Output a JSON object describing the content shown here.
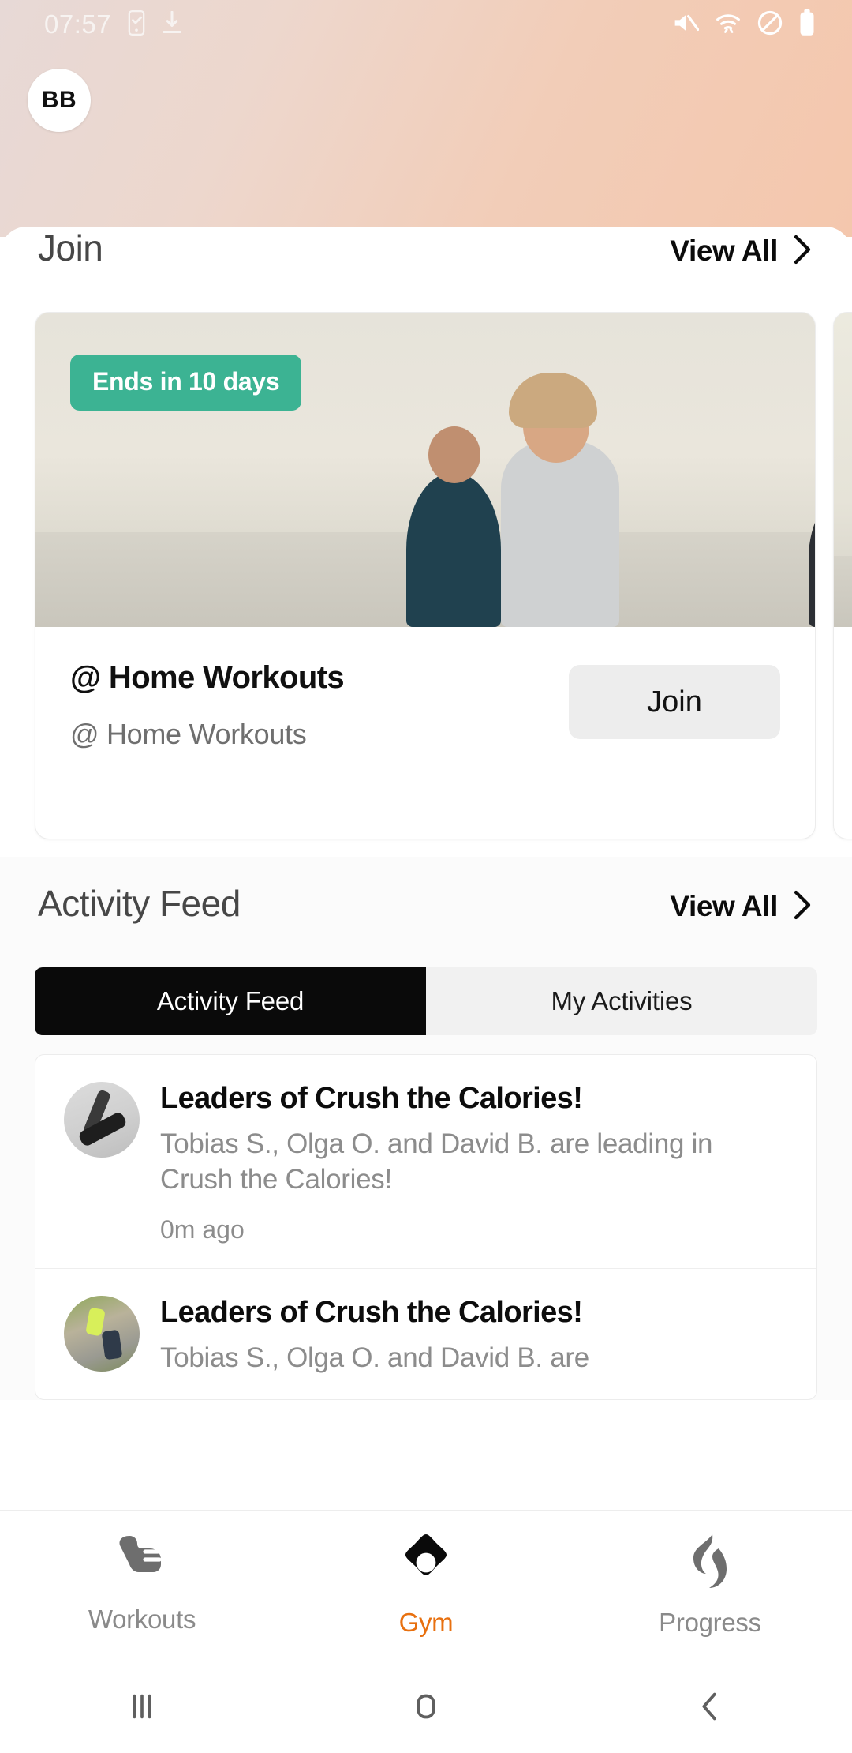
{
  "status_bar": {
    "time": "07:57",
    "left_icons": [
      "task-icon",
      "download-icon"
    ],
    "right_icons": [
      "mute-icon",
      "wifi-icon",
      "do-not-disturb-icon",
      "battery-icon"
    ]
  },
  "header": {
    "avatar_initials": "BB",
    "background_colors": [
      "#e7d9d6",
      "#f4c7ad"
    ]
  },
  "join_section": {
    "title": "Join",
    "view_all": "View All",
    "cards": [
      {
        "badge": "Ends in 10 days",
        "title": "@ Home Workouts",
        "subtitle": "@ Home Workouts",
        "action": "Join",
        "badge_color": "#3cb393",
        "image_alt": "group-of-runners-beach"
      },
      {
        "badge": "",
        "title": "",
        "subtitle": "",
        "action": "",
        "image_alt": "second-challenge-card"
      }
    ]
  },
  "activity_section": {
    "title": "Activity Feed",
    "view_all": "View All",
    "tabs": [
      {
        "label": "Activity Feed",
        "active": true
      },
      {
        "label": "My Activities",
        "active": false
      }
    ],
    "items": [
      {
        "title": "Leaders of Crush the Calories!",
        "body": "Tobias S., Olga O. and David B. are leading in Crush the Calories!",
        "time": "0m ago",
        "thumb": "yoga-pose-thumbnail"
      },
      {
        "title": "Leaders of Crush the Calories!",
        "body": "Tobias S., Olga O. and David B. are",
        "time": "",
        "thumb": "runners-on-path-thumbnail"
      }
    ]
  },
  "bottom_nav": {
    "active_color": "#e8700f",
    "inactive_color": "#8a8a8a",
    "items": [
      {
        "label": "Workouts",
        "icon": "shoe-icon",
        "active": false
      },
      {
        "label": "Gym",
        "icon": "gym-diamond-icon",
        "active": true
      },
      {
        "label": "Progress",
        "icon": "flame-icon",
        "active": false
      }
    ]
  },
  "system_nav": {
    "recents": "recents-icon",
    "home": "home-icon",
    "back": "back-icon"
  }
}
